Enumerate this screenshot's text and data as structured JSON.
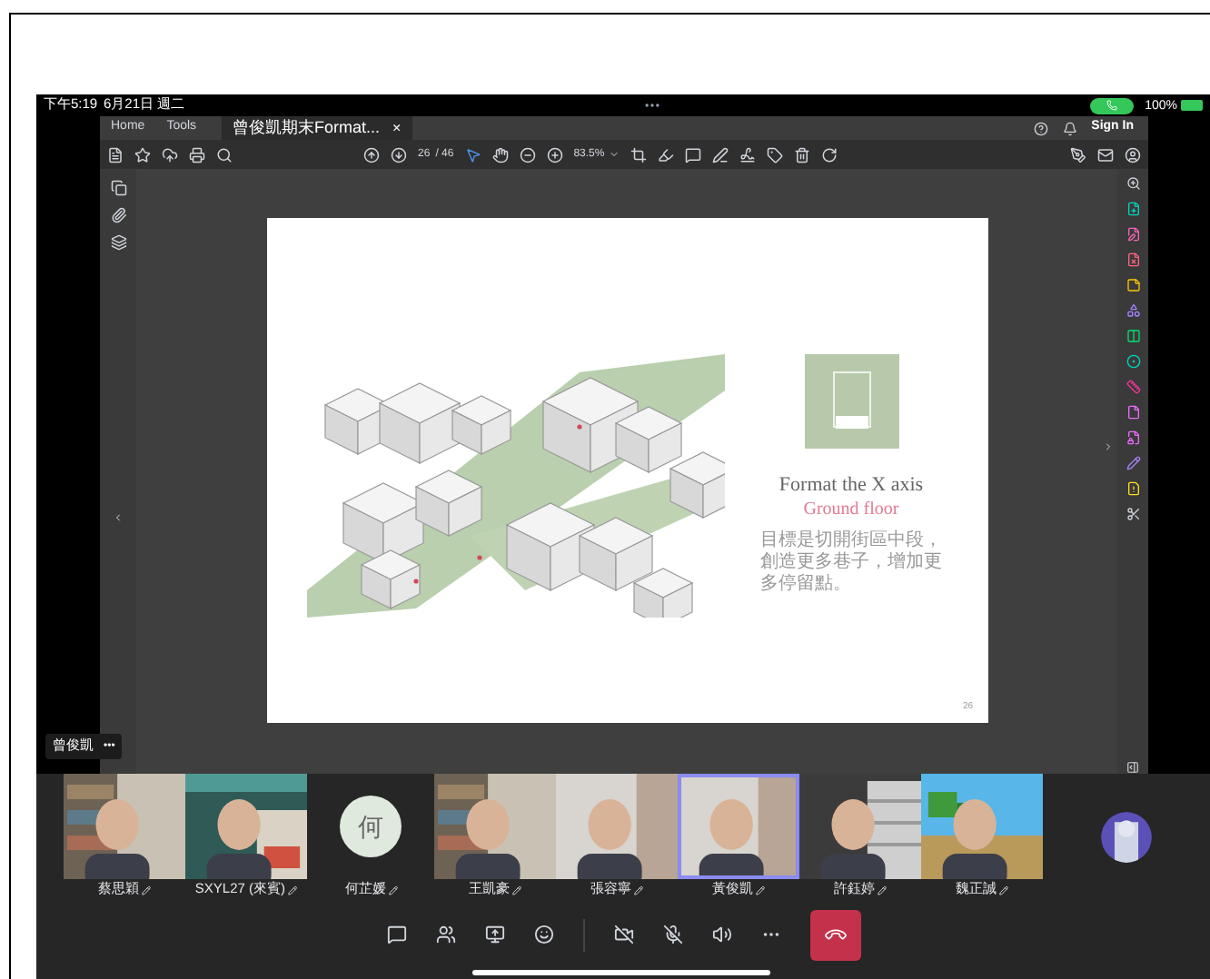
{
  "status_bar": {
    "time": "下午5:19",
    "date": "6月21日 週二",
    "battery": "100%"
  },
  "tab_bar": {
    "items": [
      {
        "label": "Home",
        "selected": false
      },
      {
        "label": "Tools",
        "selected": false
      }
    ],
    "document_tab": {
      "label": "曾俊凱期末Format...",
      "close": "×",
      "selected": true
    },
    "sign_in": "Sign In"
  },
  "toolbar": {
    "page": "26",
    "page_total": "/ 46",
    "zoom": "83.5%"
  },
  "slide": {
    "title": "Format the X axis",
    "subtitle": "Ground floor",
    "body": "目標是切開街區中段，創造更多巷子，增加更多停留點。",
    "page_number": "26"
  },
  "presenter_badge": {
    "name": "曾俊凱",
    "more": "•••"
  },
  "participants": [
    {
      "kind": "video",
      "name": "蔡思穎",
      "selected": false
    },
    {
      "kind": "video",
      "name": "SXYL27 (來賓)",
      "selected": false
    },
    {
      "kind": "avatar",
      "initial": "何",
      "name": "何芷媛",
      "selected": false
    },
    {
      "kind": "video",
      "name": "王凱豪",
      "selected": false
    },
    {
      "kind": "video",
      "name": "張容寧",
      "selected": false
    },
    {
      "kind": "video",
      "name": "黃俊凱",
      "selected": true
    },
    {
      "kind": "video",
      "name": "許鈺婷",
      "selected": false
    },
    {
      "kind": "video",
      "name": "魏正誠",
      "selected": false
    }
  ]
}
